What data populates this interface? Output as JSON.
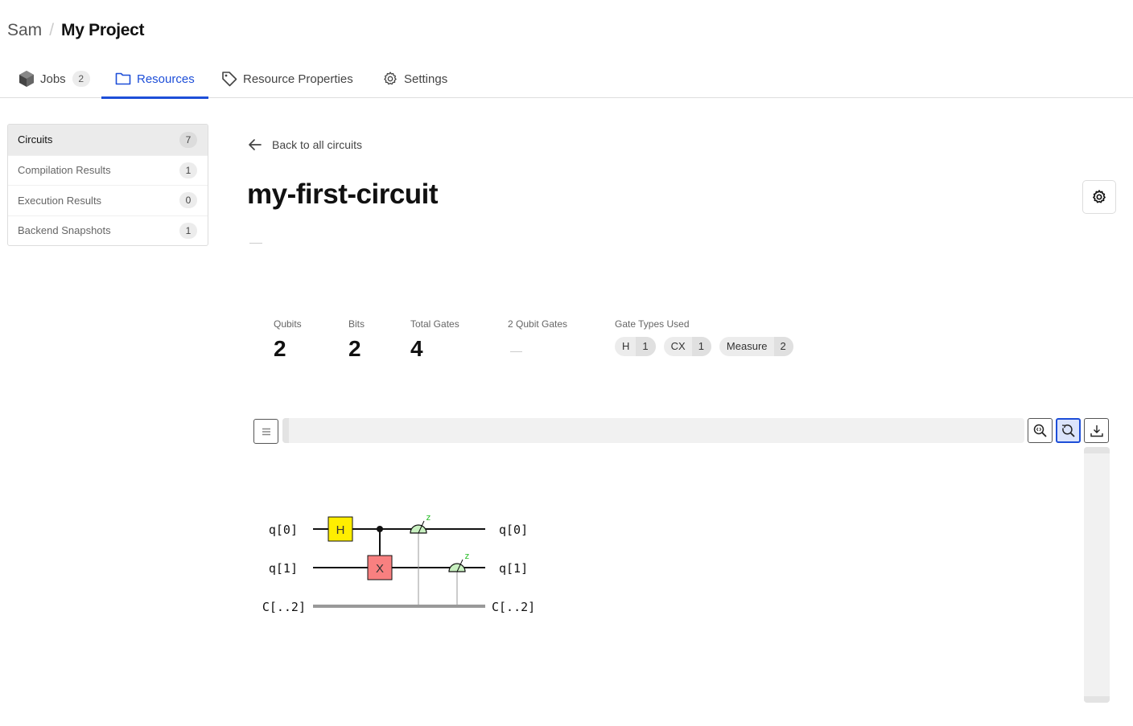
{
  "breadcrumb": {
    "user": "Sam",
    "separator": "/",
    "project": "My Project"
  },
  "tabs": [
    {
      "label": "Jobs",
      "icon": "cube-icon",
      "badge": "2",
      "active": false
    },
    {
      "label": "Resources",
      "icon": "folder-icon",
      "active": true
    },
    {
      "label": "Resource Properties",
      "icon": "tag-icon",
      "active": false
    },
    {
      "label": "Settings",
      "icon": "gear-icon",
      "active": false
    }
  ],
  "sidebar": {
    "items": [
      {
        "label": "Circuits",
        "count": "7",
        "selected": true
      },
      {
        "label": "Compilation Results",
        "count": "1"
      },
      {
        "label": "Execution Results",
        "count": "0"
      },
      {
        "label": "Backend Snapshots",
        "count": "1"
      }
    ]
  },
  "main": {
    "back_label": "Back to all circuits",
    "title": "my-first-circuit",
    "description": "—",
    "stats": {
      "qubits_label": "Qubits",
      "qubits": "2",
      "bits_label": "Bits",
      "bits": "2",
      "total_gates_label": "Total Gates",
      "total_gates": "4",
      "two_qubit_label": "2 Qubit Gates",
      "two_qubit": "—",
      "gate_types_label": "Gate Types Used",
      "gate_types": [
        {
          "name": "H",
          "count": "1"
        },
        {
          "name": "CX",
          "count": "1"
        },
        {
          "name": "Measure",
          "count": "2"
        }
      ]
    },
    "viewer": {
      "menu_icon": "menu-icon",
      "zoom_fit_icon": "zoom-fit-icon",
      "zoom_reset_icon": "zoom-reset-icon",
      "download_icon": "download-icon",
      "active_tool": "zoom-reset",
      "accent": "#1d4ed8"
    },
    "circuit": {
      "wires": [
        {
          "label": "q[0]",
          "type": "quantum"
        },
        {
          "label": "q[1]",
          "type": "quantum"
        },
        {
          "label": "C[..2]",
          "type": "classical"
        }
      ],
      "gates": [
        {
          "type": "H",
          "label": "H",
          "target": 0,
          "color": "#ffee00"
        },
        {
          "type": "CX",
          "label": "X",
          "control": 0,
          "target": 1,
          "color": "#f88080"
        },
        {
          "type": "Measure",
          "target": 0,
          "basis": "z",
          "color": "#c8f0c0"
        },
        {
          "type": "Measure",
          "target": 1,
          "basis": "z",
          "color": "#c8f0c0"
        }
      ]
    }
  }
}
